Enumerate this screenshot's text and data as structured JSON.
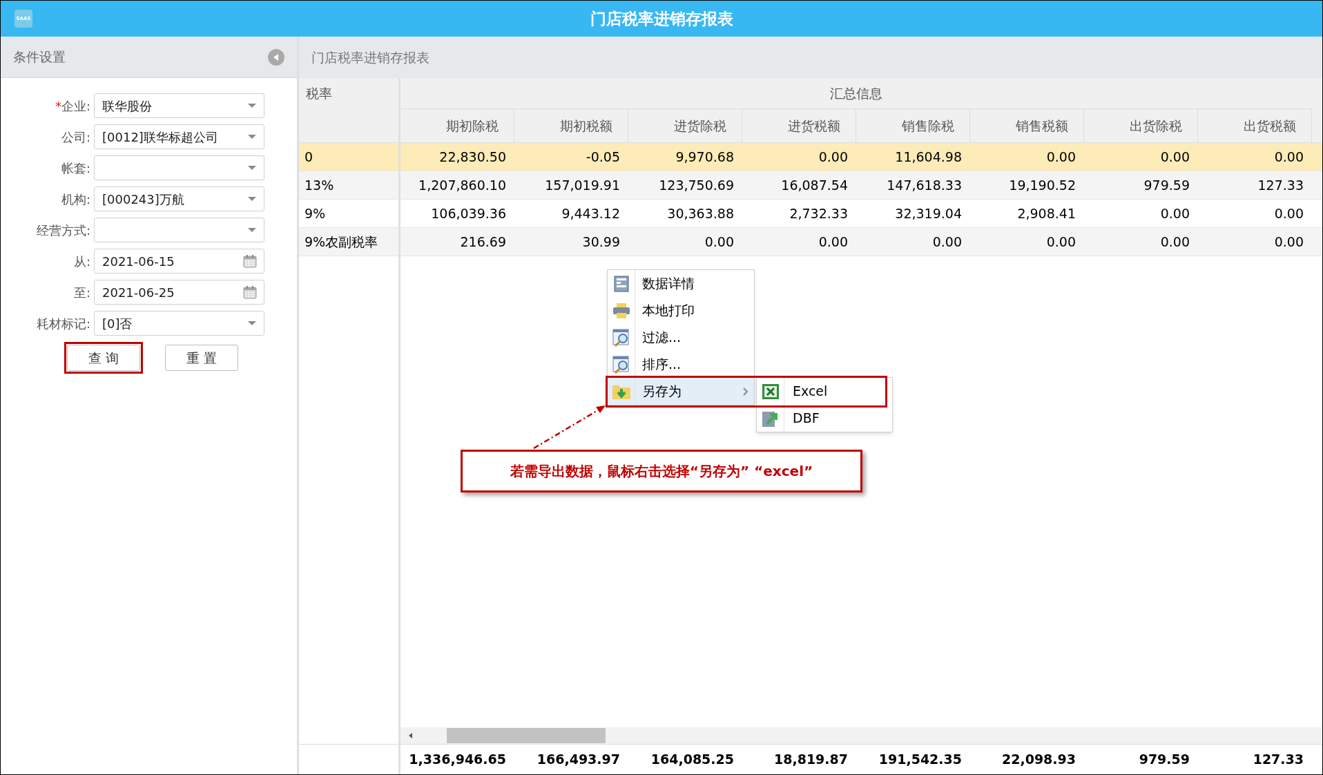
{
  "window": {
    "title": "门店税率进销存报表",
    "logo_text": "SAAS"
  },
  "filter_panel": {
    "title": "条件设置",
    "collapse_icon": true,
    "fields": [
      {
        "required_mark": "*",
        "label": "企业:",
        "value": "联华股份",
        "kind": "select"
      },
      {
        "label": "公司:",
        "value": "[0012]联华标超公司",
        "kind": "select"
      },
      {
        "label": "帐套:",
        "kind": "select"
      },
      {
        "label": "机构:",
        "value": "[000243]万航",
        "kind": "select"
      },
      {
        "label": "经营方式:",
        "kind": "select"
      },
      {
        "label": "从:",
        "value": "2021-06-15",
        "kind": "date"
      },
      {
        "label": "至:",
        "value": "2021-06-25",
        "kind": "date"
      },
      {
        "label": "耗材标记:",
        "value": "[0]否",
        "kind": "select"
      }
    ],
    "buttons": [
      {
        "label": "查 询",
        "annotated": true
      },
      {
        "label": "重 置",
        "annotated": false
      }
    ]
  },
  "report": {
    "title": "门店税率进销存报表",
    "table": {
      "rate_header": "税率",
      "group_header": "汇总信息",
      "columns": [
        "期初除税",
        "期初税额",
        "进货除税",
        "进货税额",
        "销售除税",
        "销售税额",
        "出货除税",
        "出货税额"
      ],
      "rows": [
        {
          "rate": "0",
          "selected": true,
          "values": [
            "22,830.50",
            "-0.05",
            "9,970.68",
            "0.00",
            "11,604.98",
            "0.00",
            "0.00",
            "0.00"
          ]
        },
        {
          "rate": "13%",
          "selected": false,
          "values": [
            "1,207,860.10",
            "157,019.91",
            "123,750.69",
            "16,087.54",
            "147,618.33",
            "19,190.52",
            "979.59",
            "127.33"
          ]
        },
        {
          "rate": "9%",
          "selected": false,
          "values": [
            "106,039.36",
            "9,443.12",
            "30,363.88",
            "2,732.33",
            "32,319.04",
            "2,908.41",
            "0.00",
            "0.00"
          ]
        },
        {
          "rate": "9%农副税率",
          "selected": false,
          "values": [
            "216.69",
            "30.99",
            "0.00",
            "0.00",
            "0.00",
            "0.00",
            "0.00",
            "0.00"
          ]
        }
      ],
      "totals": [
        "1,336,946.65",
        "166,493.97",
        "164,085.25",
        "18,819.87",
        "191,542.35",
        "22,098.93",
        "979.59",
        "127.33"
      ]
    },
    "context_menu": {
      "items": [
        {
          "label": "数据详情",
          "highlighted": false,
          "submenu": false,
          "annotated": false
        },
        {
          "label": "本地打印",
          "highlighted": false,
          "submenu": false,
          "annotated": false
        },
        {
          "label": "过滤...",
          "highlighted": false,
          "submenu": false,
          "annotated": false
        },
        {
          "label": "排序...",
          "highlighted": false,
          "submenu": false,
          "annotated": false
        },
        {
          "label": "另存为",
          "highlighted": true,
          "submenu": true,
          "annotated": true
        }
      ],
      "submenu_items": [
        {
          "label": "Excel"
        },
        {
          "label": "DBF"
        }
      ]
    },
    "annotation": {
      "text": "若需导出数据，鼠标右击选择“另存为” “excel”"
    }
  }
}
